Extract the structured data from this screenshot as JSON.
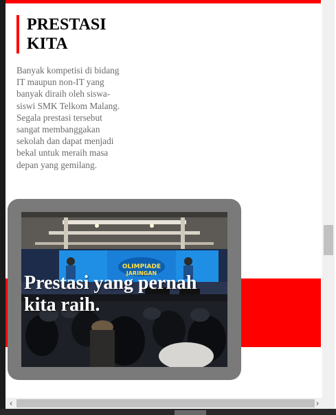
{
  "section": {
    "title": "PRESTASI KITA",
    "description": "Banyak kompetisi di bidang IT maupun non-IT yang banyak diraih oleh siswa-siswi SMK Telkom Malang. Segala prestasi tersebut sangat membanggakan sekolah dan dapat menjadi bekal untuk meraih masa depan yang gemilang."
  },
  "card": {
    "caption": "Prestasi yang pernah kita raih."
  },
  "scrollbar": {
    "left_arrow": "‹",
    "right_arrow": "›"
  },
  "colors": {
    "accent": "#ff0000",
    "card_bg": "#7a7a7a",
    "text_muted": "#6b6b6b"
  }
}
